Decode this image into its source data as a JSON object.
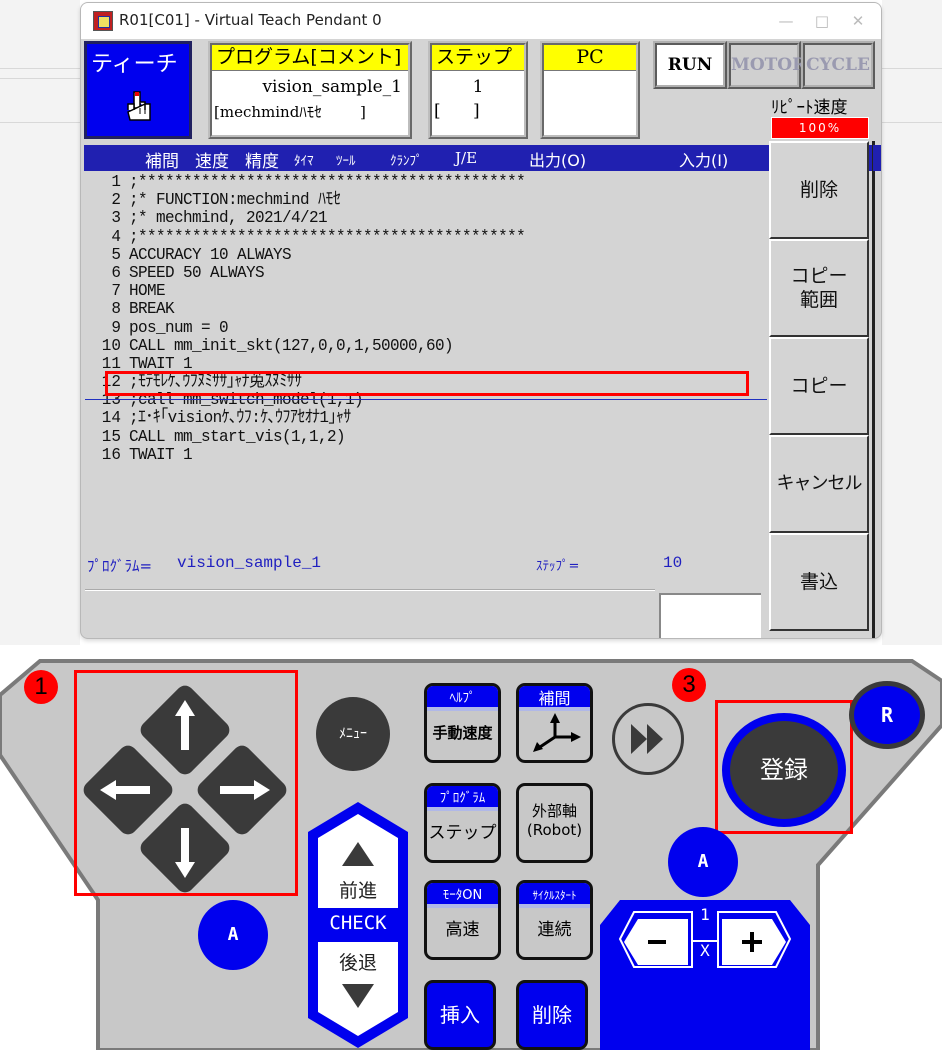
{
  "window": {
    "title": "R01[C01] - Virtual Teach Pendant 0",
    "controls": {
      "minimize": "—",
      "maximize": "□",
      "close": "✕"
    }
  },
  "header": {
    "mode_label": "ティーチ",
    "mode_icon": "teach-hand-icon",
    "program": {
      "heading": "プログラム[コメント]",
      "value": "vision_sample_1",
      "comment": "[mechmindﾊﾓｾ        ]"
    },
    "step": {
      "heading": "ステップ",
      "value": "1",
      "comment": "[      ]"
    },
    "pc": {
      "heading": "PC",
      "value": ""
    },
    "status_buttons": [
      {
        "label": "RUN",
        "active": true
      },
      {
        "label": "MOTOR",
        "active": false
      },
      {
        "label": "CYCLE",
        "active": false
      }
    ],
    "repeat_speed": {
      "label": "ﾘﾋﾟｰﾄ速度",
      "value": "100%",
      "percent": 100,
      "color": "#ff0000"
    }
  },
  "columns": [
    "補間",
    "速度",
    "精度",
    "ﾀｲﾏ",
    "ﾂｰﾙ",
    "ｸﾗﾝﾌﾟ",
    "J/E",
    "出力(O)",
    "入力(I)"
  ],
  "listing": [
    {
      "n": "1",
      "code": ";*******************************************"
    },
    {
      "n": "2",
      "code": ";* FUNCTION:mechmind ﾊﾓｾ"
    },
    {
      "n": "3",
      "code": ";* mechmind, 2021/4/21"
    },
    {
      "n": "4",
      "code": ";*******************************************"
    },
    {
      "n": "5",
      "code": "ACCURACY 10 ALWAYS"
    },
    {
      "n": "6",
      "code": "SPEED 50 ALWAYS"
    },
    {
      "n": "7",
      "code": "HOME"
    },
    {
      "n": "8",
      "code": "BREAK"
    },
    {
      "n": "9",
      "code": "pos_num = 0"
    },
    {
      "n": "10",
      "code": "CALL mm_init_skt(127,0,0,1,50000,60)"
    },
    {
      "n": "11",
      "code": "TWAIT 1"
    },
    {
      "n": "12",
      "code": ";ﾓﾃﾓﾚｹ､ｳﾌﾇﾐｻｻ｣ｬﾅ莵ｽﾇﾐｻｻ"
    },
    {
      "n": "13",
      "code": ";call mm_switch_model(1,1)"
    },
    {
      "n": "14",
      "code": ";ｴ･ｷ｢visionｹ､ｳﾌ:ｹ､ｳﾌｱｾｵﾅ1｣ｬｻ"
    },
    {
      "n": "15",
      "code": "CALL mm_start_vis(1,1,2)"
    },
    {
      "n": "16",
      "code": "TWAIT 1"
    }
  ],
  "highlighted_line": "10",
  "side_buttons": [
    "削除",
    "コピー\n範囲",
    "コピー",
    "キャンセル",
    "書込"
  ],
  "footer": {
    "program_label": "ﾌﾟﾛｸﾞﾗﾑ=",
    "program_value": "vision_sample_1",
    "step_label": "ｽﾃｯﾌﾟ=",
    "step_value": "10",
    "input_value": ""
  },
  "pendant": {
    "badges": [
      "1",
      "3"
    ],
    "dpad": [
      "up-arrow-icon",
      "left-arrow-icon",
      "right-arrow-icon",
      "down-arrow-icon"
    ],
    "menu_label": "ﾒﾆｭｰ",
    "keys": [
      {
        "top": "ﾍﾙﾌﾟ",
        "bottom": "手動速度"
      },
      {
        "top": "補間",
        "bottom": ""
      },
      {
        "top": "ﾌﾟﾛｸﾞﾗﾑ",
        "bottom": "ステップ"
      },
      {
        "top": "",
        "bottom": "外部軸\n(Robot)"
      },
      {
        "top": "ﾓｰﾀON",
        "bottom": "高速"
      },
      {
        "top": "ｻｲｸﾙｽﾀｰﾄ",
        "bottom": "連続"
      }
    ],
    "check": {
      "forward": "前進",
      "label": "CHECK",
      "backward": "後退"
    },
    "insert_label": "挿入",
    "delete_label": "削除",
    "register_label": "登録",
    "a_label": "A",
    "r_label": "R",
    "speed": {
      "minus": "−",
      "plus": "+",
      "numerator": "1",
      "denominator": "X"
    },
    "accent_blue": "#0000ee"
  }
}
